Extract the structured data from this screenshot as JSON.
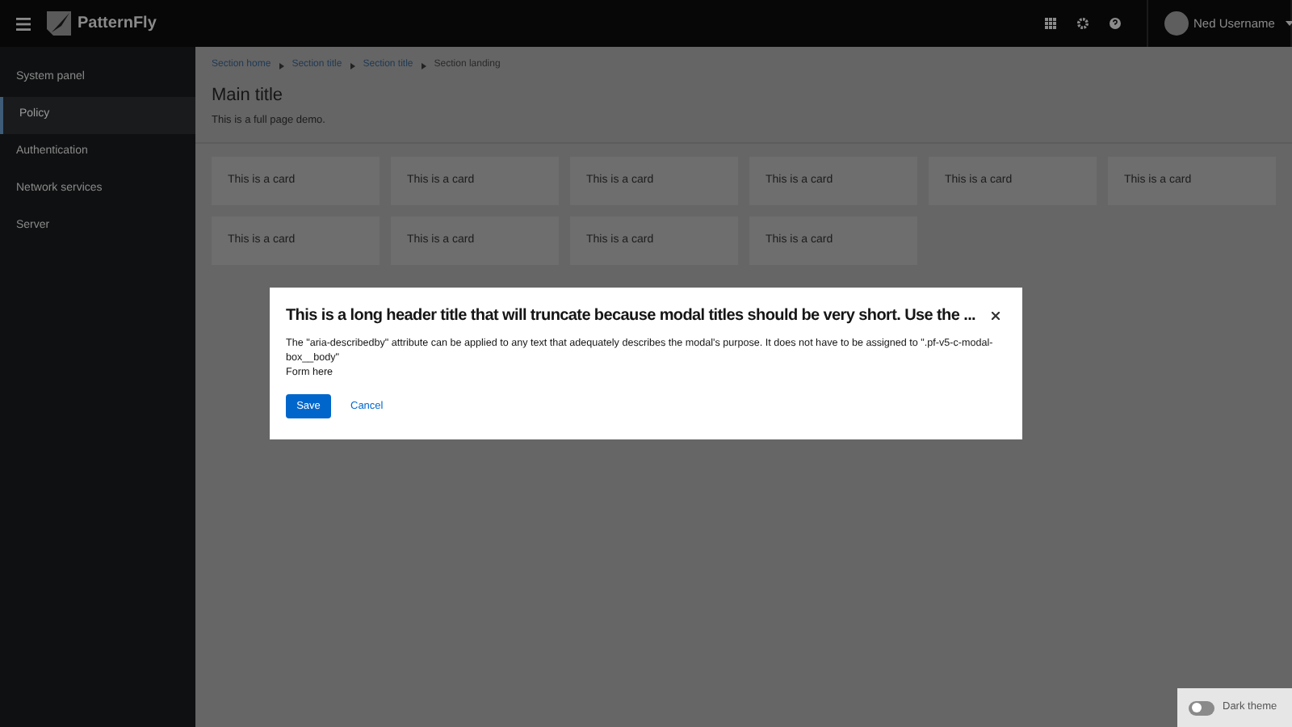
{
  "header": {
    "brand": "PatternFly",
    "user": "Ned Username"
  },
  "sidebar": {
    "items": [
      {
        "label": "System panel",
        "selected": false
      },
      {
        "label": "Policy",
        "selected": true
      },
      {
        "label": "Authentication",
        "selected": false
      },
      {
        "label": "Network services",
        "selected": false
      },
      {
        "label": "Server",
        "selected": false
      }
    ]
  },
  "breadcrumb": [
    {
      "label": "Section home",
      "kind": "link"
    },
    {
      "label": "Section title",
      "kind": "link"
    },
    {
      "label": "Section title",
      "kind": "link"
    },
    {
      "label": "Section landing",
      "kind": "current"
    }
  ],
  "page": {
    "title": "Main title",
    "subtitle": "This is a full page demo."
  },
  "cards": [
    "This is a card",
    "This is a card",
    "This is a card",
    "This is a card",
    "This is a card",
    "This is a card",
    "This is a card",
    "This is a card",
    "This is a card",
    "This is a card"
  ],
  "modal": {
    "title": "This is a long header title that will truncate because modal titles should be very short. Use the ...",
    "description": "The \"aria-describedby\" attribute can be applied to any text that adequately describes the modal's purpose. It does not have to be assigned to \".pf-v5-c-modal-box__body\"",
    "body": "Form here",
    "save": "Save",
    "cancel": "Cancel"
  },
  "theme_toggle": {
    "label": "Dark theme",
    "on": false
  }
}
